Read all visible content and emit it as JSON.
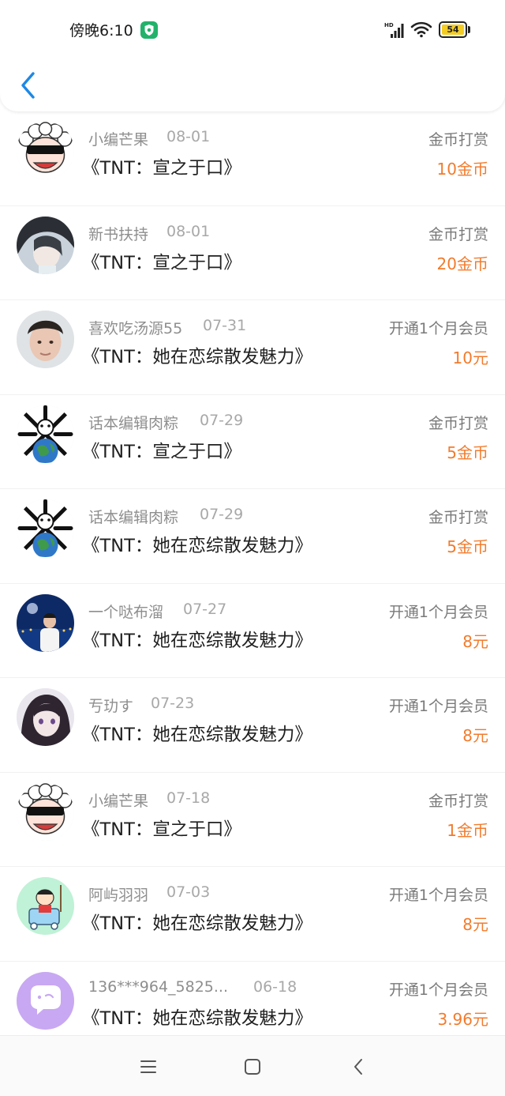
{
  "status_bar": {
    "time": "傍晚6:10",
    "battery": "54",
    "network_label": "HD"
  },
  "colors": {
    "accent": "#1e88e5",
    "amount": "#f27b2c",
    "name": "#8e8e8e",
    "title": "#202020"
  },
  "header": {
    "back_icon": "chevron-left-icon"
  },
  "records": [
    {
      "user": "小编芒果",
      "date": "08-01",
      "book": "《TNT：宣之于口》",
      "type": "金币打赏",
      "amount": "10金币",
      "avatar": "sheep-sunglasses"
    },
    {
      "user": "新书扶持",
      "date": "08-01",
      "book": "《TNT：宣之于口》",
      "type": "金币打赏",
      "amount": "20金币",
      "avatar": "anime-man"
    },
    {
      "user": "喜欢吃汤源55",
      "date": "07-31",
      "book": "《TNT：她在恋综散发魅力》",
      "type": "开通1个月会员",
      "amount": "10元",
      "avatar": "photo-young-man"
    },
    {
      "user": "话本编辑肉粽",
      "date": "07-29",
      "book": "《TNT：宣之于口》",
      "type": "金币打赏",
      "amount": "5金币",
      "avatar": "earth-bones"
    },
    {
      "user": "话本编辑肉粽",
      "date": "07-29",
      "book": "《TNT：她在恋综散发魅力》",
      "type": "金币打赏",
      "amount": "5金币",
      "avatar": "earth-bones"
    },
    {
      "user": "一个哒布溜",
      "date": "07-27",
      "book": "《TNT：她在恋综散发魅力》",
      "type": "开通1个月会员",
      "amount": "8元",
      "avatar": "night-city"
    },
    {
      "user": "亐玏す",
      "date": "07-23",
      "book": "《TNT：她在恋综散发魅力》",
      "type": "开通1个月会员",
      "amount": "8元",
      "avatar": "anime-girl"
    },
    {
      "user": "小编芒果",
      "date": "07-18",
      "book": "《TNT：宣之于口》",
      "type": "金币打赏",
      "amount": "1金币",
      "avatar": "sheep-sunglasses"
    },
    {
      "user": "阿屿羽羽",
      "date": "07-03",
      "book": "《TNT：她在恋综散发魅力》",
      "type": "开通1个月会员",
      "amount": "8元",
      "avatar": "cartoon-kid"
    },
    {
      "user": "136***964_5825...",
      "date": "06-18",
      "book": "《TNT：她在恋综散发魅力》",
      "type": "开通1个月会员",
      "amount": "3.96元",
      "avatar": "chat-bubble"
    }
  ],
  "navbar": {
    "items": [
      "menu-icon",
      "home-square-icon",
      "back-triangle-icon"
    ]
  }
}
